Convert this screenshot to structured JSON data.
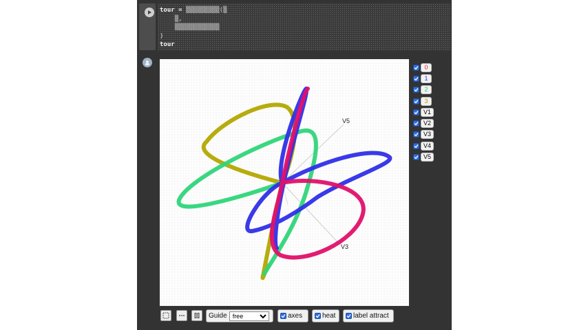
{
  "cell": {
    "code_lines": [
      "tour = ",
      "    ",
      "    ",
      ")",
      "tour"
    ]
  },
  "legend": {
    "items": [
      {
        "label": "0",
        "color": "#e8202f"
      },
      {
        "label": "1",
        "color": "#2b35e0"
      },
      {
        "label": "2",
        "color": "#2ec96a"
      },
      {
        "label": "3",
        "color": "#b3a400"
      },
      {
        "label": "V1",
        "color": "#111111"
      },
      {
        "label": "V2",
        "color": "#111111"
      },
      {
        "label": "V3",
        "color": "#111111"
      },
      {
        "label": "V4",
        "color": "#111111"
      },
      {
        "label": "V5",
        "color": "#111111"
      }
    ]
  },
  "plot": {
    "axis_labels": {
      "v5": "V5",
      "v3": "V3"
    },
    "series_colors": {
      "red": "#e0106a",
      "blue": "#2f2fe8",
      "green": "#2fd57a",
      "yellow": "#b3a800"
    }
  },
  "toolbar": {
    "guide_label": "Guide",
    "guide_selected": "free",
    "axes_label": "axes",
    "heat_label": "heat",
    "label_attract": "label attract"
  }
}
